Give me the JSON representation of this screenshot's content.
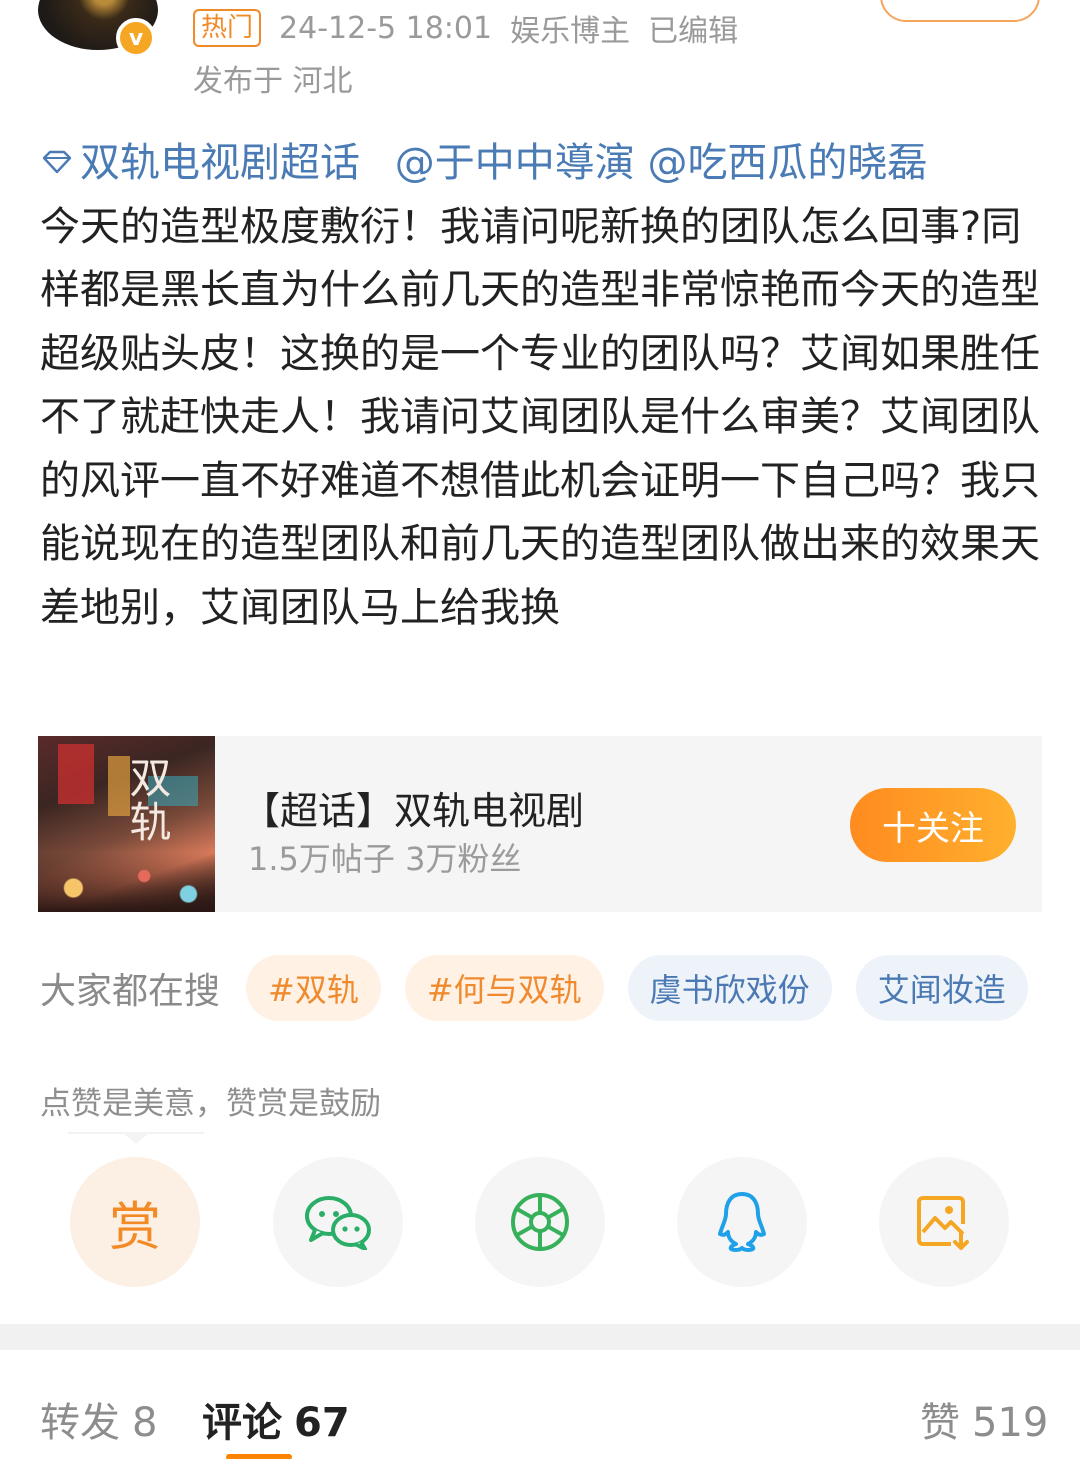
{
  "header": {
    "hot_tag": "热门",
    "time": "24-12-5 18:01",
    "author_type": "娱乐博主",
    "edited": "已编辑",
    "location": "发布于 河北"
  },
  "post": {
    "supertopic": "双轨电视剧超话",
    "mentions": [
      "@于中中導演",
      "@吃西瓜的晓磊"
    ],
    "text": "今天的造型极度敷衍！我请问呢新换的团队怎么回事?同样都是黑长直为什么前几天的造型非常惊艳而今天的造型超级贴头皮！这换的是一个专业的团队吗？艾闻如果胜任不了就赶快走人！我请问艾闻团队是什么审美？艾闻团队的风评一直不好难道不想借此机会证明一下自己吗？我只能说现在的造型团队和前几天的造型团队做出来的效果天差地别，艾闻团队马上给我换"
  },
  "card": {
    "thumb_text": "双轨",
    "title": "【超话】双轨电视剧",
    "stats": "1.5万帖子 3万粉丝",
    "follow_label": "十关注"
  },
  "search": {
    "label": "大家都在搜",
    "chips": [
      {
        "text": "#双轨",
        "style": "hot"
      },
      {
        "text": "#何与双轨",
        "style": "hot"
      },
      {
        "text": "虞书欣戏份",
        "style": "normal"
      },
      {
        "text": "艾闻妆造",
        "style": "normal"
      }
    ]
  },
  "reward": {
    "text": "点赞是美意，赞赏是鼓励",
    "reward_glyph": "赏",
    "share_icons": [
      "reward-icon",
      "wechat-icon",
      "moments-icon",
      "qq-icon",
      "save-image-icon"
    ]
  },
  "tabs": {
    "repost_label": "转发",
    "repost_count": "8",
    "comment_label": "评论",
    "comment_count": "67",
    "like_label": "赞",
    "like_count": "519"
  },
  "colors": {
    "accent": "#ff8200",
    "link": "#4a7bb5",
    "wechat": "#2aae67",
    "qq": "#1fa1e9"
  }
}
